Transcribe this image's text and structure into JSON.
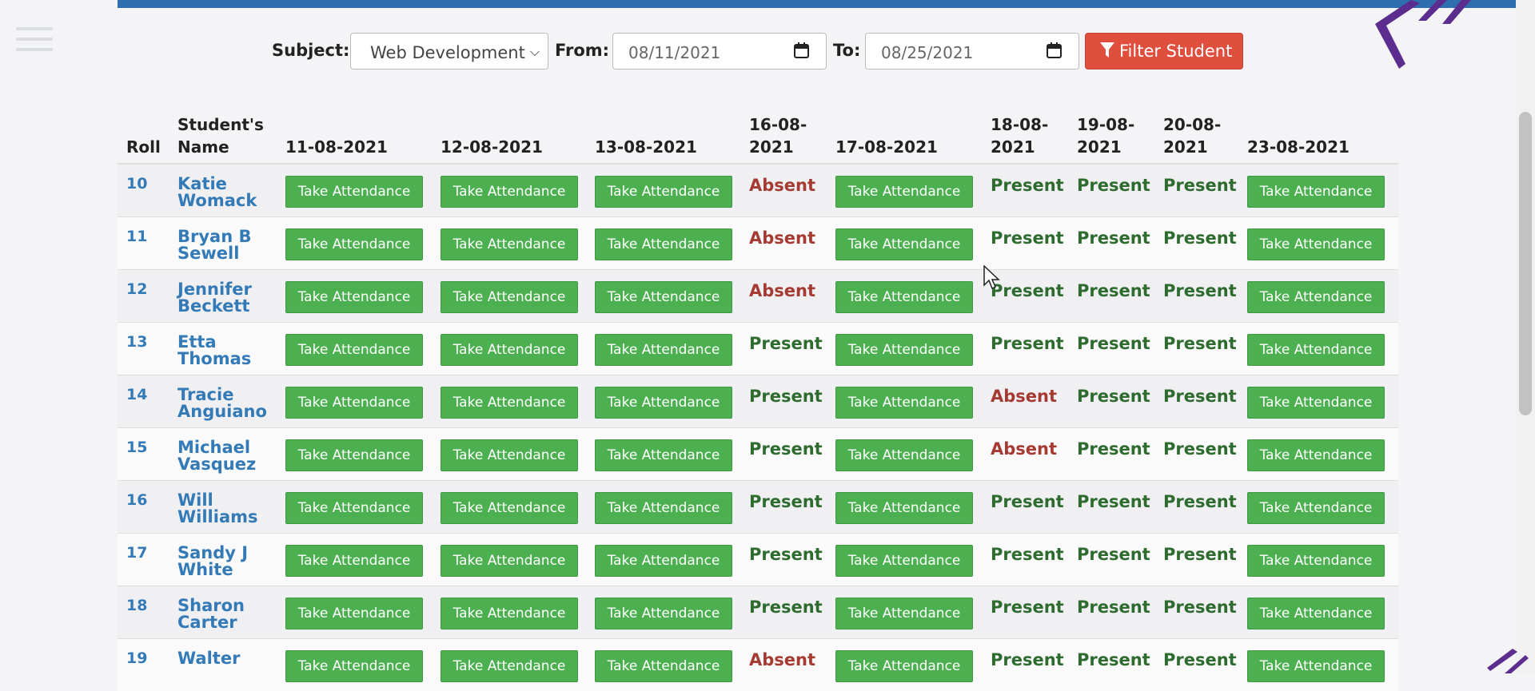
{
  "filter": {
    "subject_label": "Subject:",
    "subject_value": "Web Development",
    "from_label": "From:",
    "from_value": "08/11/2021",
    "to_label": "To:",
    "to_value": "08/25/2021",
    "button_label": "Filter Student"
  },
  "table": {
    "headers": [
      {
        "lines": [
          "Roll"
        ]
      },
      {
        "lines": [
          "Student's",
          "Name"
        ]
      },
      {
        "lines": [
          "11-08-2021"
        ]
      },
      {
        "lines": [
          "12-08-2021"
        ]
      },
      {
        "lines": [
          "13-08-2021"
        ]
      },
      {
        "lines": [
          "16-08-",
          "2021"
        ]
      },
      {
        "lines": [
          "17-08-2021"
        ]
      },
      {
        "lines": [
          "18-08-",
          "2021"
        ]
      },
      {
        "lines": [
          "19-08-",
          "2021"
        ]
      },
      {
        "lines": [
          "20-08-",
          "2021"
        ]
      },
      {
        "lines": [
          "23-08-2021"
        ]
      }
    ],
    "take_label": "Take Attendance",
    "rows": [
      {
        "roll": "10",
        "name": [
          "Katie",
          "Womack"
        ],
        "cells": [
          "take",
          "take",
          "take",
          "Absent",
          "take",
          "Present",
          "Present",
          "Present",
          "take"
        ]
      },
      {
        "roll": "11",
        "name": [
          "Bryan B",
          "Sewell"
        ],
        "cells": [
          "take",
          "take",
          "take",
          "Absent",
          "take",
          "Present",
          "Present",
          "Present",
          "take"
        ]
      },
      {
        "roll": "12",
        "name": [
          "Jennifer",
          "Beckett"
        ],
        "cells": [
          "take",
          "take",
          "take",
          "Absent",
          "take",
          "Present",
          "Present",
          "Present",
          "take"
        ]
      },
      {
        "roll": "13",
        "name": [
          "Etta",
          "Thomas"
        ],
        "cells": [
          "take",
          "take",
          "take",
          "Present",
          "take",
          "Present",
          "Present",
          "Present",
          "take"
        ]
      },
      {
        "roll": "14",
        "name": [
          "Tracie",
          "Anguiano"
        ],
        "cells": [
          "take",
          "take",
          "take",
          "Present",
          "take",
          "Absent",
          "Present",
          "Present",
          "take"
        ]
      },
      {
        "roll": "15",
        "name": [
          "Michael",
          "Vasquez"
        ],
        "cells": [
          "take",
          "take",
          "take",
          "Present",
          "take",
          "Absent",
          "Present",
          "Present",
          "take"
        ]
      },
      {
        "roll": "16",
        "name": [
          "Will",
          "Williams"
        ],
        "cells": [
          "take",
          "take",
          "take",
          "Present",
          "take",
          "Present",
          "Present",
          "Present",
          "take"
        ]
      },
      {
        "roll": "17",
        "name": [
          "Sandy J",
          "White"
        ],
        "cells": [
          "take",
          "take",
          "take",
          "Present",
          "take",
          "Present",
          "Present",
          "Present",
          "take"
        ]
      },
      {
        "roll": "18",
        "name": [
          "Sharon",
          "Carter"
        ],
        "cells": [
          "take",
          "take",
          "take",
          "Present",
          "take",
          "Present",
          "Present",
          "Present",
          "take"
        ]
      },
      {
        "roll": "19",
        "name": [
          "Walter",
          ""
        ],
        "cells": [
          "take",
          "take",
          "take",
          "Absent",
          "take",
          "Present",
          "Present",
          "Present",
          "take"
        ]
      }
    ]
  },
  "icons": {
    "menu": "hamburger-menu-icon",
    "calendar": "calendar-icon",
    "filter": "funnel-icon",
    "cursor": "mouse-pointer-icon"
  },
  "colors": {
    "topbar": "#2f6faf",
    "take_button": "#4caf50",
    "filter_button": "#e04e3e",
    "present": "#2e6b2f",
    "absent": "#a53a32",
    "link": "#337ab7",
    "logo": "#5b2d8e"
  }
}
